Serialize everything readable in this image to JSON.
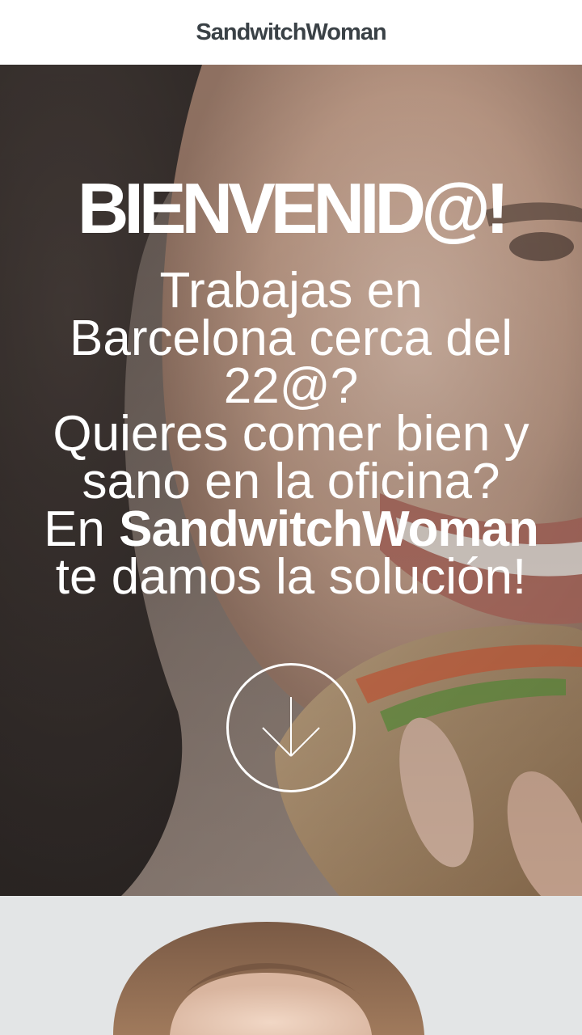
{
  "header": {
    "brand": "SandwitchWoman"
  },
  "hero": {
    "title": "BIENVENID@!",
    "lines": [
      "Trabajas en",
      "Barcelona cerca del",
      "22@?",
      "Quieres comer bien y",
      "sano en la oficina?"
    ],
    "line_en_prefix": "En ",
    "line_en_brand": "SandwitchWoman",
    "line_last": "te damos la solución!",
    "scroll_icon": "arrow-down-icon"
  },
  "colors": {
    "header_bg": "#ffffff",
    "brand_text": "#3a4146",
    "hero_text": "#ffffff",
    "section_two_bg": "#e3e5e6"
  }
}
